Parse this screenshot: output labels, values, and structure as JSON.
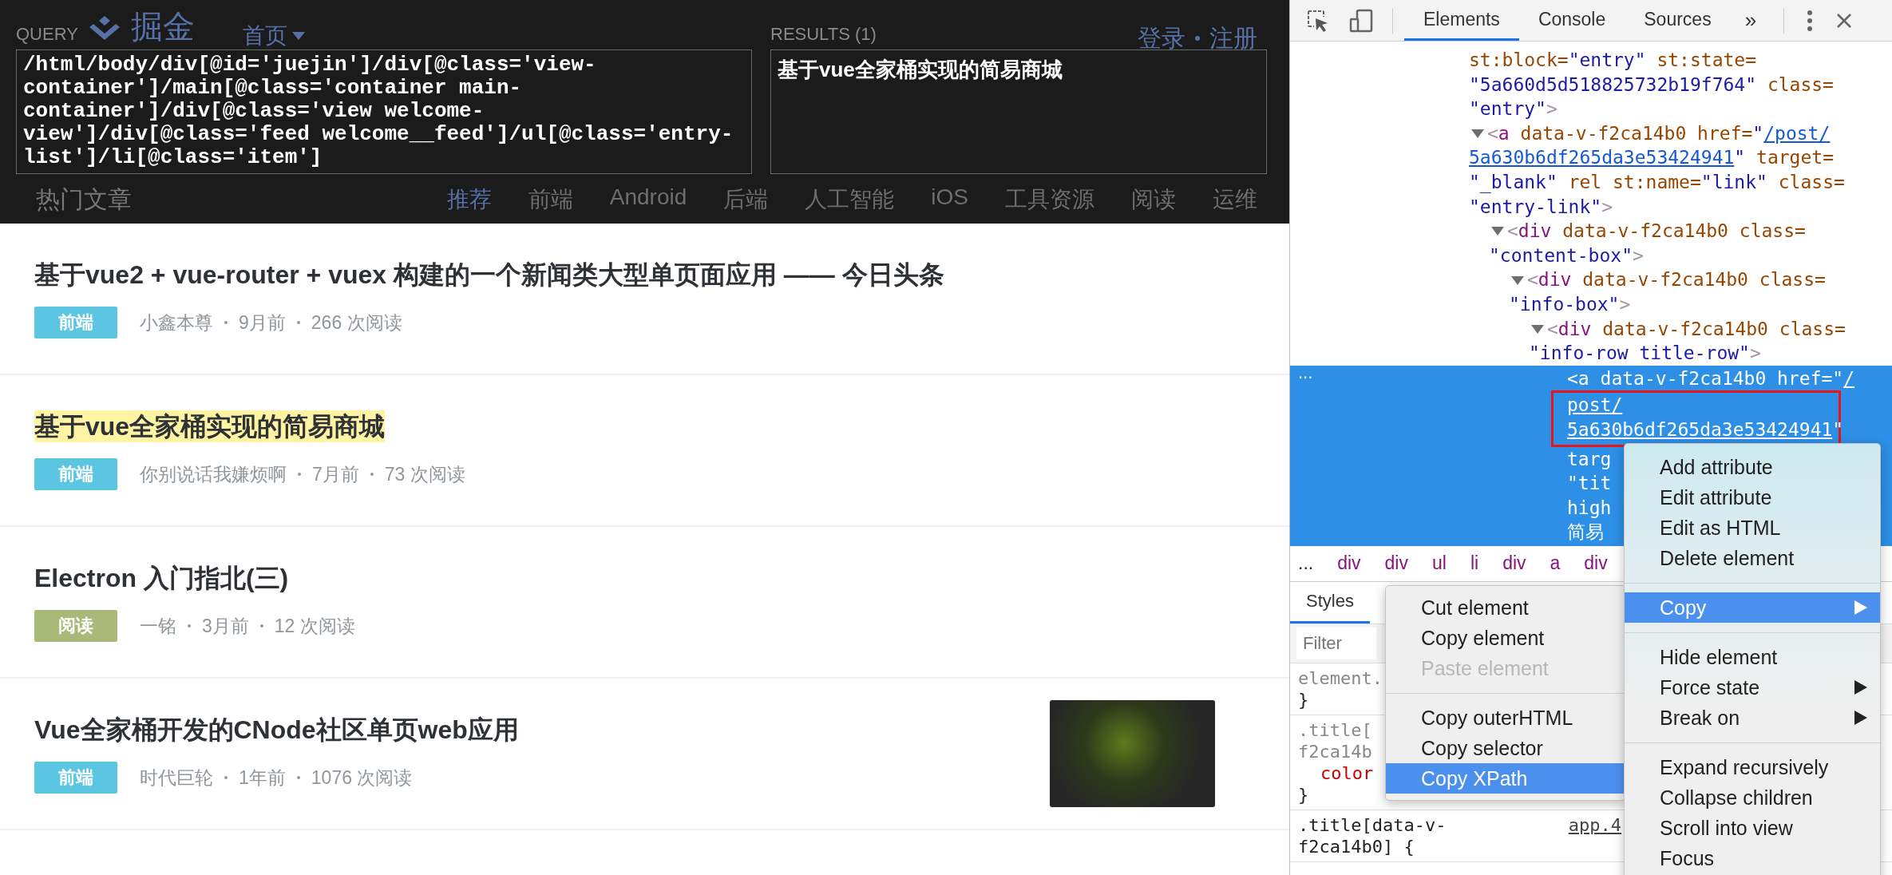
{
  "query_panel": {
    "query_label": "QUERY",
    "query": "/html/body/div[@id='juejin']/div[@class='view-container']/main[@class='container main-container']/div[@class='view welcome-view']/div[@class='feed welcome__feed']/ul[@class='entry-list']/li[@class='item']",
    "results_label": "RESULTS (1)",
    "results": [
      "基于vue全家桶实现的简易商城"
    ]
  },
  "site_header": {
    "logo": "掘金",
    "nav": "首页",
    "auth_links": [
      "登录",
      "注册"
    ]
  },
  "section_title": "热门文章",
  "category_tabs": [
    {
      "label": "推荐",
      "selected": true
    },
    {
      "label": "前端",
      "selected": false
    },
    {
      "label": "Android",
      "selected": false
    },
    {
      "label": "后端",
      "selected": false
    },
    {
      "label": "人工智能",
      "selected": false
    },
    {
      "label": "iOS",
      "selected": false
    },
    {
      "label": "工具资源",
      "selected": false
    },
    {
      "label": "阅读",
      "selected": false
    },
    {
      "label": "运维",
      "selected": false
    }
  ],
  "articles": [
    {
      "title": "基于vue2 + vue-router + vuex 构建的一个新闻类大型单页面应用 —— 今日头条",
      "highlighted": false,
      "tag": {
        "label": "前端",
        "color": "#5bc5e2"
      },
      "meta": [
        "小鑫本尊",
        "9月前",
        "266 次阅读"
      ],
      "thumbnail": false
    },
    {
      "title": "基于vue全家桶实现的简易商城",
      "highlighted": true,
      "tag": {
        "label": "前端",
        "color": "#5bc5e2"
      },
      "meta": [
        "你别说话我嫌烦啊",
        "7月前",
        "73 次阅读"
      ],
      "thumbnail": false
    },
    {
      "title": "Electron 入门指北(三)",
      "highlighted": false,
      "tag": {
        "label": "阅读",
        "color": "#a9b97a"
      },
      "meta": [
        "一铭",
        "3月前",
        "12 次阅读"
      ],
      "thumbnail": false
    },
    {
      "title": "Vue全家桶开发的CNode社区单页web应用",
      "highlighted": false,
      "tag": {
        "label": "前端",
        "color": "#5bc5e2"
      },
      "meta": [
        "时代巨轮",
        "1年前",
        "1076 次阅读"
      ],
      "thumbnail": true
    }
  ],
  "devtools": {
    "tabs": [
      {
        "label": "Elements",
        "selected": true
      },
      {
        "label": "Console",
        "selected": false
      },
      {
        "label": "Sources",
        "selected": false
      }
    ],
    "more_tabs": "»",
    "tree": {
      "lines": [
        {
          "segments": [
            {
              "kind": "attr",
              "text": "st:block="
            },
            {
              "kind": "value",
              "text": "\"entry\""
            },
            {
              "kind": "attr",
              "text": " st:state="
            }
          ]
        },
        {
          "segments": [
            {
              "kind": "value",
              "text": "\"5a660d5d518825732b19f764\""
            },
            {
              "kind": "attr",
              "text": " class="
            }
          ]
        },
        {
          "segments": [
            {
              "kind": "value",
              "text": "\"entry\""
            },
            {
              "kind": "punct",
              "text": ">"
            }
          ]
        }
      ],
      "children": [
        {
          "expanded": true,
          "selected": false,
          "lines": [
            {
              "segments": [
                {
                  "kind": "punct",
                  "text": "<"
                },
                {
                  "kind": "tag",
                  "text": "a"
                },
                {
                  "kind": "attr",
                  "text": " data-v-f2ca14b0 href="
                },
                {
                  "kind": "value",
                  "text": "\""
                },
                {
                  "kind": "link",
                  "text": "/post/"
                }
              ]
            },
            {
              "segments": [
                {
                  "kind": "link",
                  "text": "5a630b6df265da3e53424941"
                },
                {
                  "kind": "value",
                  "text": "\""
                },
                {
                  "kind": "attr",
                  "text": " target="
                }
              ]
            },
            {
              "segments": [
                {
                  "kind": "value",
                  "text": "\"_blank\""
                },
                {
                  "kind": "attr",
                  "text": " rel st:name="
                },
                {
                  "kind": "value",
                  "text": "\"link\""
                },
                {
                  "kind": "attr",
                  "text": " class="
                }
              ]
            },
            {
              "segments": [
                {
                  "kind": "value",
                  "text": "\"entry-link\""
                },
                {
                  "kind": "punct",
                  "text": ">"
                }
              ]
            }
          ],
          "children": [
            {
              "expanded": true,
              "selected": false,
              "lines": [
                {
                  "segments": [
                    {
                      "kind": "punct",
                      "text": "<"
                    },
                    {
                      "kind": "tag",
                      "text": "div"
                    },
                    {
                      "kind": "attr",
                      "text": " data-v-f2ca14b0 class="
                    }
                  ]
                },
                {
                  "segments": [
                    {
                      "kind": "value",
                      "text": "\"content-box\""
                    },
                    {
                      "kind": "punct",
                      "text": ">"
                    }
                  ]
                }
              ],
              "children": [
                {
                  "expanded": true,
                  "selected": false,
                  "lines": [
                    {
                      "segments": [
                        {
                          "kind": "punct",
                          "text": "<"
                        },
                        {
                          "kind": "tag",
                          "text": "div"
                        },
                        {
                          "kind": "attr",
                          "text": " data-v-f2ca14b0 class="
                        }
                      ]
                    },
                    {
                      "segments": [
                        {
                          "kind": "value",
                          "text": "\"info-box\""
                        },
                        {
                          "kind": "punct",
                          "text": ">"
                        }
                      ]
                    }
                  ],
                  "children": [
                    {
                      "expanded": true,
                      "selected": false,
                      "lines": [
                        {
                          "segments": [
                            {
                              "kind": "punct",
                              "text": "<"
                            },
                            {
                              "kind": "tag",
                              "text": "div"
                            },
                            {
                              "kind": "attr",
                              "text": " data-v-f2ca14b0 class="
                            }
                          ]
                        },
                        {
                          "segments": [
                            {
                              "kind": "value",
                              "text": "\"info-row title-row\""
                            },
                            {
                              "kind": "punct",
                              "text": ">"
                            }
                          ]
                        }
                      ],
                      "children": [
                        {
                          "selected": true,
                          "more": "...",
                          "lines": [
                            {
                              "outlined": false,
                              "segments": [
                                {
                                  "kind": "punct",
                                  "text": "<"
                                },
                                {
                                  "kind": "tag",
                                  "text": "a"
                                },
                                {
                                  "kind": "attr",
                                  "text": " data-v-f2ca14b0 href="
                                },
                                {
                                  "kind": "value",
                                  "text": "\""
                                },
                                {
                                  "kind": "link",
                                  "text": "/"
                                }
                              ]
                            },
                            {
                              "outlined": true,
                              "segments": [
                                {
                                  "kind": "link",
                                  "text": "post/"
                                }
                              ]
                            },
                            {
                              "outlined": true,
                              "segments": [
                                {
                                  "kind": "link",
                                  "text": "5a630b6df265da3e53424941"
                                },
                                {
                                  "kind": "value",
                                  "text": "\""
                                }
                              ]
                            },
                            {
                              "outlined": false,
                              "segments": [
                                {
                                  "kind": "attr",
                                  "text": "targ"
                                }
                              ]
                            },
                            {
                              "outlined": false,
                              "segments": [
                                {
                                  "kind": "value",
                                  "text": "\"tit"
                                }
                              ]
                            },
                            {
                              "outlined": false,
                              "segments": [
                                {
                                  "kind": "attr",
                                  "text": "high"
                                }
                              ]
                            },
                            {
                              "outlined": false,
                              "segments": [
                                {
                                  "kind": "value",
                                  "text": "简易"
                                }
                              ]
                            }
                          ]
                        }
                      ]
                    }
                  ]
                }
              ]
            }
          ]
        }
      ]
    },
    "breadcrumbs": [
      "...",
      "div",
      "div",
      "ul",
      "li",
      "div",
      "a",
      "div"
    ],
    "styles_tabs": [
      {
        "label": "Styles",
        "selected": true
      }
    ],
    "filter": {
      "placeholder": "Filter"
    },
    "rules": [
      {
        "lines": [
          {
            "kind": "selector_dim",
            "text": "element."
          },
          {
            "kind": "brace",
            "text": "}"
          }
        ]
      },
      {
        "lines": [
          {
            "kind": "selector_dim",
            "text": ".title["
          },
          {
            "kind": "selector_dim",
            "text": "f2ca14b"
          },
          {
            "kind": "property",
            "text": "color"
          },
          {
            "kind": "brace",
            "text": "}"
          }
        ]
      },
      {
        "lines": [
          {
            "kind": "selector",
            "text": ".title[data-v-"
          },
          {
            "kind": "selector",
            "text": "f2ca14b0] {"
          }
        ],
        "source": "app.4"
      }
    ],
    "context_menu": {
      "items": [
        {
          "kind": "item",
          "label": "Add attribute",
          "selected": false,
          "disabled": false,
          "has_submenu": false
        },
        {
          "kind": "item",
          "label": "Edit attribute",
          "selected": false,
          "disabled": false,
          "has_submenu": false
        },
        {
          "kind": "item",
          "label": "Edit as HTML",
          "selected": false,
          "disabled": false,
          "has_submenu": false
        },
        {
          "kind": "item",
          "label": "Delete element",
          "selected": false,
          "disabled": false,
          "has_submenu": false
        },
        {
          "kind": "separator"
        },
        {
          "kind": "item",
          "label": "Copy",
          "selected": true,
          "disabled": false,
          "has_submenu": true
        },
        {
          "kind": "separator"
        },
        {
          "kind": "item",
          "label": "Hide element",
          "selected": false,
          "disabled": false,
          "has_submenu": false
        },
        {
          "kind": "item",
          "label": "Force state",
          "selected": false,
          "disabled": false,
          "has_submenu": true
        },
        {
          "kind": "item",
          "label": "Break on",
          "selected": false,
          "disabled": false,
          "has_submenu": true
        },
        {
          "kind": "separator"
        },
        {
          "kind": "item",
          "label": "Expand recursively",
          "selected": false,
          "disabled": false,
          "has_submenu": false
        },
        {
          "kind": "item",
          "label": "Collapse children",
          "selected": false,
          "disabled": false,
          "has_submenu": false
        },
        {
          "kind": "item",
          "label": "Scroll into view",
          "selected": false,
          "disabled": false,
          "has_submenu": false
        },
        {
          "kind": "item",
          "label": "Focus",
          "selected": false,
          "disabled": false,
          "has_submenu": false
        }
      ]
    },
    "submenu": {
      "items": [
        {
          "kind": "item",
          "label": "Cut element",
          "selected": false,
          "disabled": false,
          "has_submenu": false
        },
        {
          "kind": "item",
          "label": "Copy element",
          "selected": false,
          "disabled": false,
          "has_submenu": false
        },
        {
          "kind": "item",
          "label": "Paste element",
          "selected": false,
          "disabled": true,
          "has_submenu": false
        },
        {
          "kind": "separator"
        },
        {
          "kind": "item",
          "label": "Copy outerHTML",
          "selected": false,
          "disabled": false,
          "has_submenu": false
        },
        {
          "kind": "item",
          "label": "Copy selector",
          "selected": false,
          "disabled": false,
          "has_submenu": false
        },
        {
          "kind": "item",
          "label": "Copy XPath",
          "selected": true,
          "disabled": false,
          "has_submenu": false
        }
      ]
    }
  }
}
